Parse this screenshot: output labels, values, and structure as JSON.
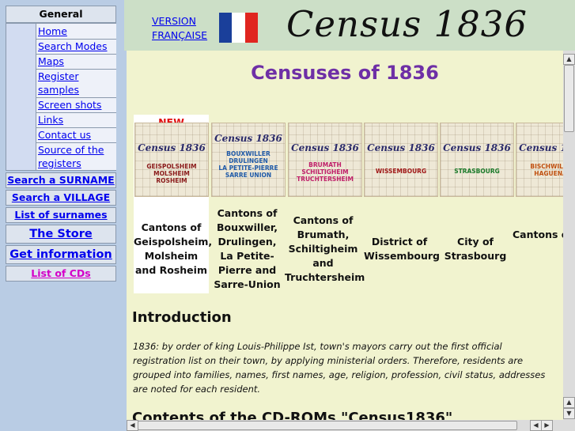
{
  "sidebar": {
    "heading": "General Information",
    "links": [
      "Home",
      "Search Modes",
      "Maps",
      "Register samples",
      "Screen shots",
      "Links",
      "Contact us",
      "Source of the registers"
    ],
    "buttons": {
      "search_surname": "Search a SURNAME",
      "search_village": "Search a VILLAGE",
      "list_surnames": "List of surnames",
      "store": "The Store",
      "get_info": "Get information",
      "list_cds": "List of CDs"
    }
  },
  "header": {
    "version_line1": "VERSION",
    "version_line2": "FRANÇAISE",
    "title": "Census 1836"
  },
  "main": {
    "title": "Censuses of 1836",
    "new_badge": "NEW",
    "thumb_title": "Census 1836",
    "cantons": [
      {
        "label": "Cantons of Geispolsheim, Molsheim and Rosheim",
        "places": "GEISPOLSHEIM\nMOLSHEIM\nROSHEIM"
      },
      {
        "label": "Cantons of Bouxwiller, Drulingen, La Petite-Pierre and Sarre-Union",
        "places": "BOUXWILLER\nDRULINGEN\nLA PETITE-PIERRE\nSARRE UNION"
      },
      {
        "label": "Cantons of Brumath, Schiltigheim and Truchtersheim",
        "places": "BRUMATH\nSCHILTIGHEIM\nTRUCHTERSHEIM"
      },
      {
        "label": "District of Wissembourg",
        "places": "WISSEMBOURG"
      },
      {
        "label": "City of Strasbourg",
        "places": "STRASBOURG"
      },
      {
        "label": "Cantons of Bischwiller and Haguenau",
        "places": "BISCHWILLER\nHAGUENAU"
      }
    ],
    "intro_heading": "Introduction",
    "intro_text": "1836: by order of king Louis-Philippe Ist, town's mayors carry out the first official registration list on their town, by applying ministerial orders. Therefore, residents are grouped into families, names, first names, age, religion, profession, civil status, addresses are noted for each resident.",
    "contents_heading": "Contents of the CD-ROMs \"Census1836\""
  },
  "colors": {
    "link": "#0000ee",
    "title_purple": "#6e2fa6",
    "new_red": "#e01010",
    "list_cds_pink": "#d400c8",
    "flag_blue": "#1a3f9a",
    "flag_red": "#e0251f"
  }
}
